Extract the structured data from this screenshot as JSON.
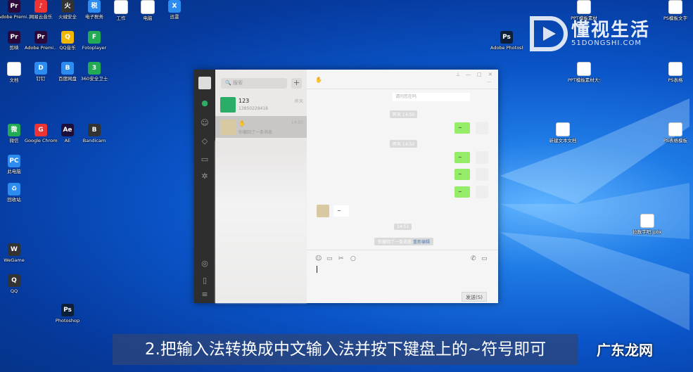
{
  "subtitle": "2.把输入法转换成中文输入法并按下键盘上的~符号即可",
  "watermark_top": {
    "name": "懂视生活",
    "url": "51DONGSHI.COM"
  },
  "watermark_bottom": "广东龙网",
  "desktop_icons": [
    {
      "label": "Adobe Premi...",
      "glyph": "Pr",
      "style": "g-pr"
    },
    {
      "label": "网易云音乐",
      "glyph": "♪",
      "style": "g-app"
    },
    {
      "label": "火绒安全",
      "glyph": "火",
      "style": "g-dark"
    },
    {
      "label": "电子税务",
      "glyph": "税",
      "style": "g-blue"
    },
    {
      "label": "工作",
      "glyph": "W",
      "style": "g-doc"
    },
    {
      "label": "电脑",
      "glyph": "W",
      "style": "g-doc"
    },
    {
      "label": "迅雷",
      "glyph": "X",
      "style": "g-blue"
    },
    {
      "label": "剪映",
      "glyph": "Pr",
      "style": "g-pr"
    },
    {
      "label": "Adobe Premi...",
      "glyph": "Pr",
      "style": "g-pr"
    },
    {
      "label": "QQ音乐",
      "glyph": "Q",
      "style": "g-yellow"
    },
    {
      "label": "Fotoplayer",
      "glyph": "F",
      "style": "g-green"
    },
    {
      "label": "文档",
      "glyph": "W",
      "style": "g-doc"
    },
    {
      "label": "钉钉",
      "glyph": "D",
      "style": "g-blue"
    },
    {
      "label": "百度网盘",
      "glyph": "B",
      "style": "g-blue"
    },
    {
      "label": "360安全卫士",
      "glyph": "3",
      "style": "g-green"
    },
    {
      "label": "微信",
      "glyph": "微",
      "style": "g-green"
    },
    {
      "label": "Google Chrome",
      "glyph": "G",
      "style": "g-app"
    },
    {
      "label": "AE",
      "glyph": "Ae",
      "style": "g-ae"
    },
    {
      "label": "Bandicam",
      "glyph": "B",
      "style": "g-dark"
    },
    {
      "label": "WeGame",
      "glyph": "W",
      "style": "g-dark"
    },
    {
      "label": "QQ",
      "glyph": "Q",
      "style": "g-dark"
    },
    {
      "label": "Photoshop",
      "glyph": "Ps",
      "style": "g-ps"
    },
    {
      "label": "此电脑",
      "glyph": "PC",
      "style": "g-blue"
    },
    {
      "label": "回收站",
      "glyph": "♻",
      "style": "g-blue"
    }
  ],
  "right_icons": [
    {
      "label": "PPT模板素材",
      "glyph": "W",
      "style": "g-doc"
    },
    {
      "label": "PS模板文字",
      "glyph": "Ps",
      "style": "g-xls"
    },
    {
      "label": "Adobe Photosh...",
      "glyph": "Ps",
      "style": "g-ps"
    },
    {
      "label": "PPT模板素材大全",
      "glyph": "W",
      "style": "g-doc"
    },
    {
      "label": "PS表格",
      "glyph": "X",
      "style": "g-xls"
    },
    {
      "label": "新建文本文档",
      "glyph": "W",
      "style": "g-doc"
    },
    {
      "label": "PS表格模板",
      "glyph": "X",
      "style": "g-xls"
    },
    {
      "label": "拉数字吧.jpbk",
      "glyph": "W",
      "style": "g-doc"
    }
  ],
  "wechat": {
    "search_placeholder": "搜索",
    "plus": "+",
    "title_emoji": "✋",
    "chats": [
      {
        "name": "123",
        "sub": "13850228418",
        "time": "昨天"
      },
      {
        "name": "✋",
        "sub": "你撤回了一条消息",
        "time": "14:50"
      }
    ],
    "top_bar_label": "请问您在吗",
    "timestamps": [
      "昨天 14:50",
      "昨天 14:52"
    ],
    "me_bubble": "~",
    "other_bubble": "~",
    "time_mid": "14:51",
    "recall_text": "你撤回了一条消息",
    "reedit": "重新编辑",
    "send_label": "发送(S)"
  }
}
